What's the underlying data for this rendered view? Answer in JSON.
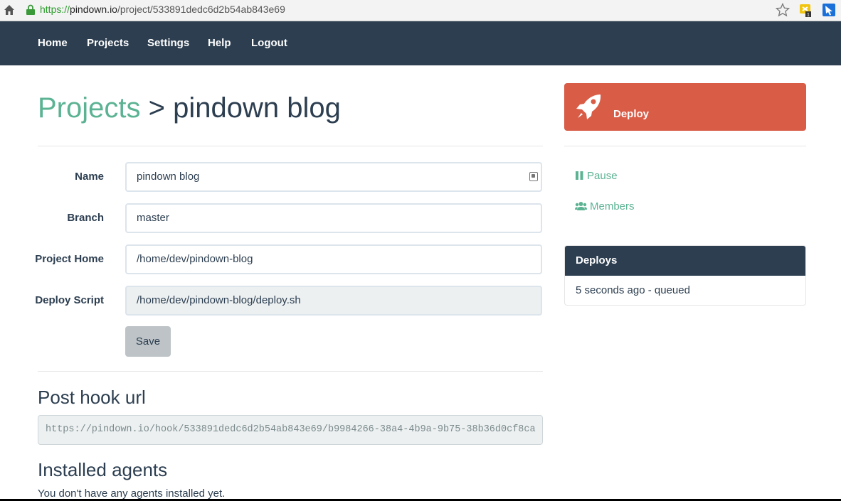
{
  "browser": {
    "url_scheme": "https://",
    "url_host": "pindown.io",
    "url_path": "/project/533891dedc6d2b54ab843e69",
    "icons": [
      "home-icon",
      "lock-icon",
      "star-icon",
      "extension-icon",
      "extension-icon"
    ]
  },
  "nav": {
    "items": [
      "Home",
      "Projects",
      "Settings",
      "Help",
      "Logout"
    ]
  },
  "title": {
    "crumb": "Projects",
    "separator": " > ",
    "project": "pindown blog"
  },
  "form": {
    "name_label": "Name",
    "name_value": "pindown blog",
    "branch_label": "Branch",
    "branch_value": "master",
    "home_label": "Project Home",
    "home_value": "/home/dev/pindown-blog",
    "script_label": "Deploy Script",
    "script_value": "/home/dev/pindown-blog/deploy.sh",
    "save_label": "Save"
  },
  "hook": {
    "title": "Post hook url",
    "url": "https://pindown.io/hook/533891dedc6d2b54ab843e69/b9984266-38a4-4b9a-9b75-38b36d0cf8ca"
  },
  "agents": {
    "title": "Installed agents",
    "empty_text": "You don't have any agents installed yet."
  },
  "sidebar": {
    "deploy_label": "Deploy",
    "pause_label": "Pause",
    "members_label": "Members",
    "deploys_title": "Deploys",
    "deploys_items": [
      "5 seconds ago - queued"
    ]
  },
  "colors": {
    "navbar": "#2c3e50",
    "accent": "#5cb393",
    "deploy": "#d95c47",
    "disabled_input": "#ecf0f1"
  }
}
